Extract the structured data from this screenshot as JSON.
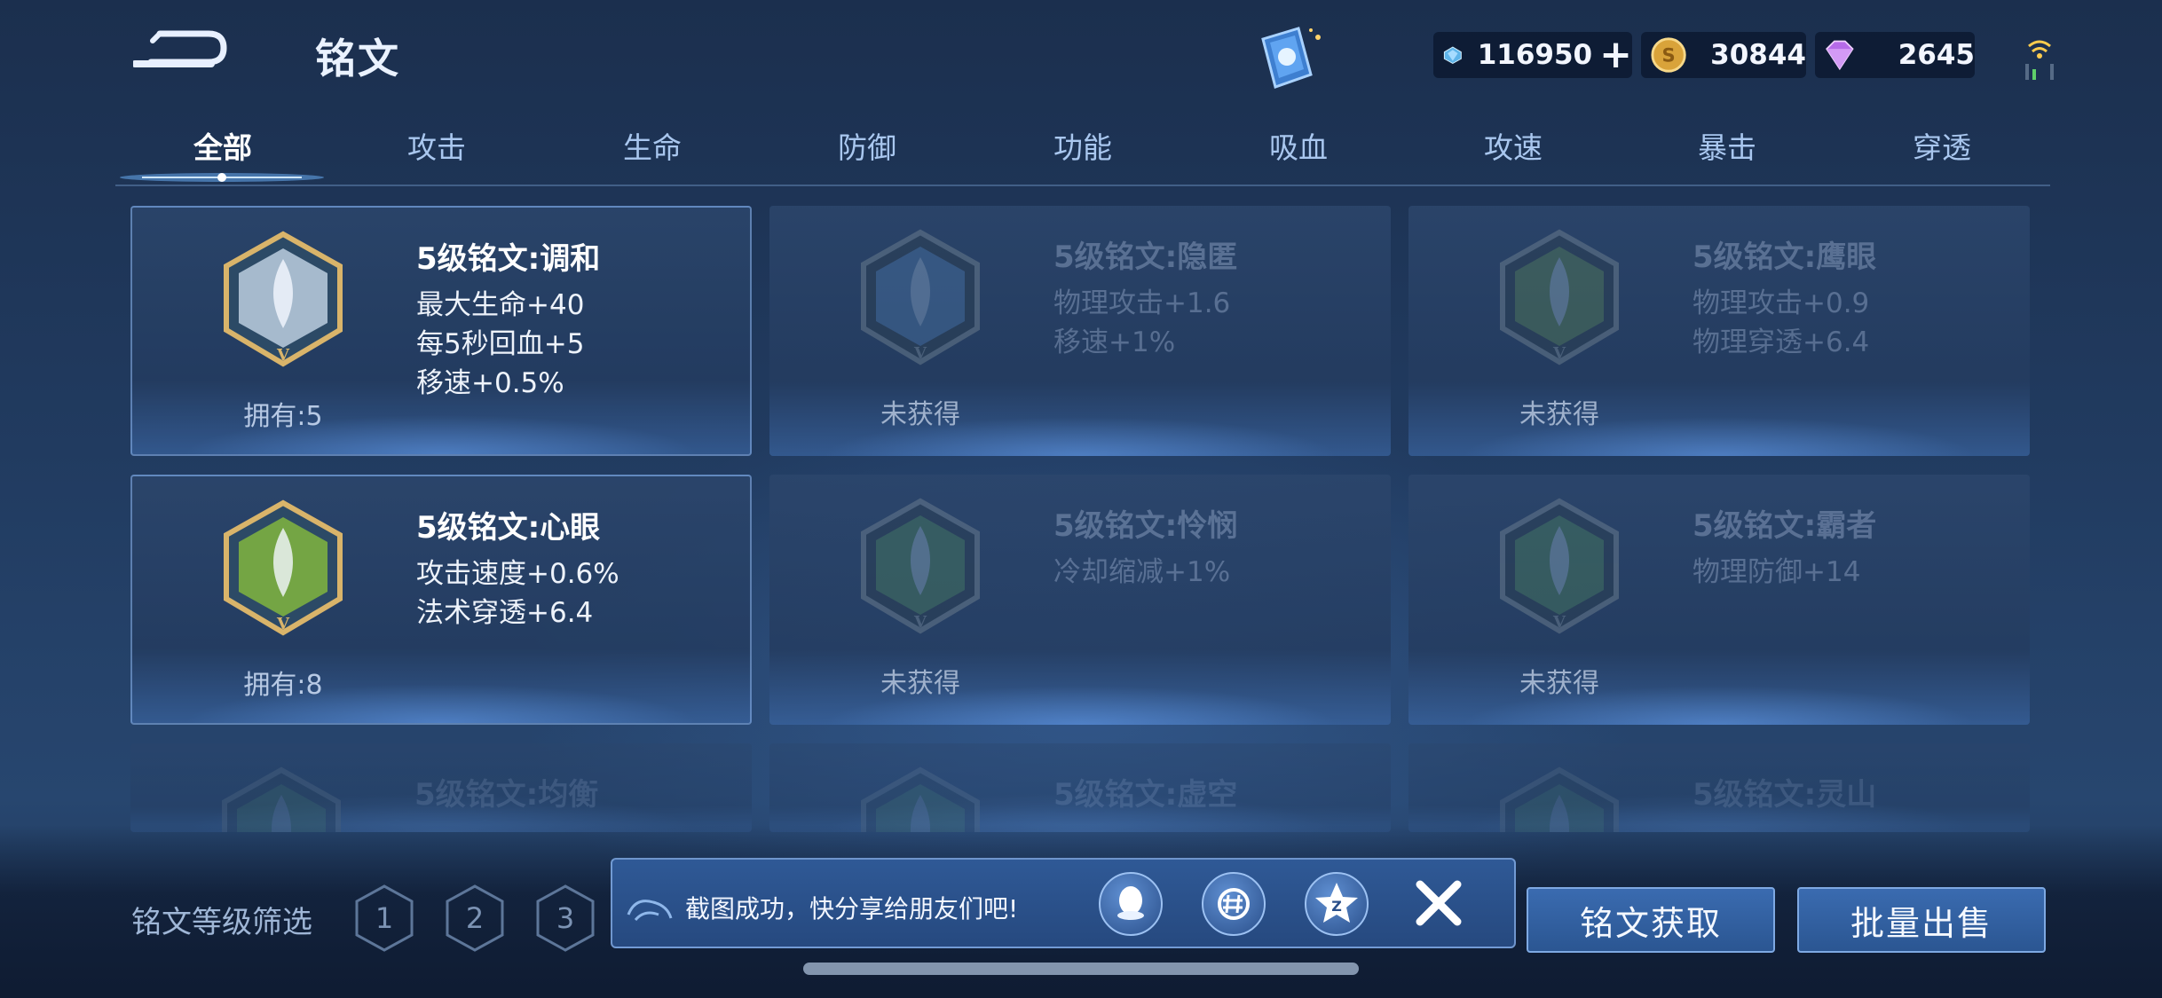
{
  "header": {
    "title": "铭文",
    "resources": [
      {
        "icon": "diamond-icon",
        "value": "116950"
      },
      {
        "icon": "gold-coin-icon",
        "value": "30844"
      },
      {
        "icon": "purple-gem-icon",
        "value": "2645"
      }
    ],
    "add_symbol": "+"
  },
  "tabs": [
    "全部",
    "攻击",
    "生命",
    "防御",
    "功能",
    "吸血",
    "攻速",
    "暴击",
    "穿透"
  ],
  "active_tab": 0,
  "cards": [
    {
      "name": "5级铭文:调和",
      "stats": [
        "最大生命+40",
        "每5秒回血+5",
        "移速+0.5%"
      ],
      "ownership": "拥有:5",
      "owned": true,
      "color": "#cfe0f0"
    },
    {
      "name": "5级铭文:隐匿",
      "stats": [
        "物理攻击+1.6",
        "移速+1%"
      ],
      "ownership": "未获得",
      "owned": false,
      "color": "#4f7fb8"
    },
    {
      "name": "5级铭文:鹰眼",
      "stats": [
        "物理攻击+0.9",
        "物理穿透+6.4"
      ],
      "ownership": "未获得",
      "owned": false,
      "color": "#5c8a5a"
    },
    {
      "name": "5级铭文:心眼",
      "stats": [
        "攻击速度+0.6%",
        "法术穿透+6.4"
      ],
      "ownership": "拥有:8",
      "owned": true,
      "color": "#8cc43a"
    },
    {
      "name": "5级铭文:怜悯",
      "stats": [
        "冷却缩减+1%"
      ],
      "ownership": "未获得",
      "owned": false,
      "color": "#4f8a62"
    },
    {
      "name": "5级铭文:霸者",
      "stats": [
        "物理防御+14"
      ],
      "ownership": "未获得",
      "owned": false,
      "color": "#4f8a62"
    },
    {
      "name": "5级铭文:均衡",
      "stats": [],
      "ownership": "",
      "owned": false,
      "color": "#4f8a62"
    },
    {
      "name": "5级铭文:虚空",
      "stats": [],
      "ownership": "",
      "owned": false,
      "color": "#4f8a62"
    },
    {
      "name": "5级铭文:灵山",
      "stats": [],
      "ownership": "",
      "owned": false,
      "color": "#4f8a62"
    }
  ],
  "filter": {
    "label": "铭文等级筛选",
    "levels": [
      "1",
      "2",
      "3"
    ]
  },
  "toast": {
    "message": "截图成功，快分享给朋友们吧!",
    "share_icons": [
      "qq-icon",
      "wechat-moments-icon",
      "qzone-icon"
    ]
  },
  "buttons": {
    "acquire": "铭文获取",
    "bulk_sell": "批量出售"
  }
}
